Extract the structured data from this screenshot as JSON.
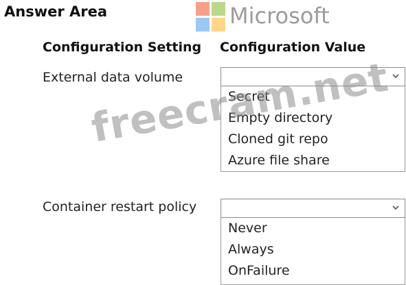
{
  "header": {
    "title": "Answer Area",
    "brand_text": "Microsoft"
  },
  "columns": {
    "setting": "Configuration Setting",
    "value": "Configuration Value"
  },
  "settings": [
    {
      "label": "External data volume",
      "selected_value": "",
      "options": [
        "Secret",
        "Empty directory",
        "Cloned git repo",
        "Azure file share"
      ]
    },
    {
      "label": "Container restart policy",
      "selected_value": "",
      "options": [
        "Never",
        "Always",
        "OnFailure"
      ]
    }
  ],
  "watermark": "freecram.net",
  "colors": {
    "logo_red": "#f6a08c",
    "logo_green": "#b9d98a",
    "logo_blue": "#9cc9f1",
    "logo_yellow": "#fdd68a",
    "brand_text": "#9c9c9c"
  },
  "icons": {
    "dropdown": "chevron-down-icon",
    "brand": "microsoft-logo"
  }
}
